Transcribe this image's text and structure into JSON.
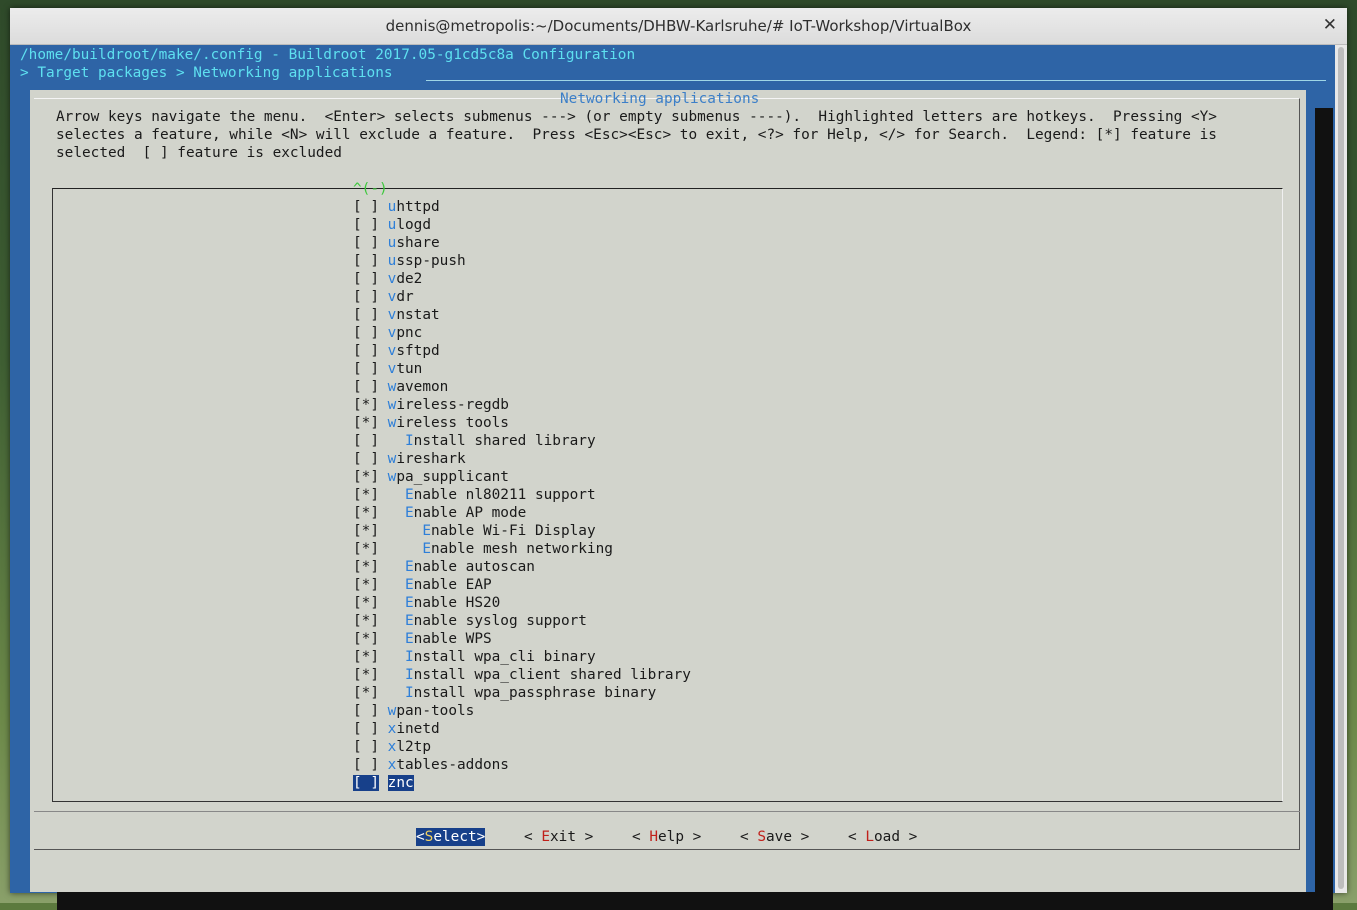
{
  "window": {
    "title": "dennis@metropolis:~/Documents/DHBW-Karlsruhe/# IoT-Workshop/VirtualBox",
    "close_glyph": "✕"
  },
  "terminal": {
    "config_path": "/home/buildroot/make/.config - Buildroot 2017.05-g1cd5c8a Configuration",
    "breadcrumb": "> Target packages > Networking applications"
  },
  "dialog": {
    "title": "Networking applications",
    "help_lines": [
      "Arrow keys navigate the menu.  <Enter> selects submenus ---> (or empty submenus ----).  Highlighted letters are hotkeys.  Pressing <Y>",
      "selectes a feature, while <N> will exclude a feature.  Press <Esc><Esc> to exit, <?> for Help, </> for Search.  Legend: [*] feature is",
      "selected  [ ] feature is excluded"
    ],
    "scroll_indicator": "^(-)",
    "items": [
      {
        "box": "[ ]",
        "indent": "",
        "hot": "u",
        "rest": "httpd"
      },
      {
        "box": "[ ]",
        "indent": "",
        "hot": "u",
        "rest": "logd"
      },
      {
        "box": "[ ]",
        "indent": "",
        "hot": "u",
        "rest": "share"
      },
      {
        "box": "[ ]",
        "indent": "",
        "hot": "u",
        "rest": "ssp-push"
      },
      {
        "box": "[ ]",
        "indent": "",
        "hot": "v",
        "rest": "de2"
      },
      {
        "box": "[ ]",
        "indent": "",
        "hot": "v",
        "rest": "dr"
      },
      {
        "box": "[ ]",
        "indent": "",
        "hot": "v",
        "rest": "nstat"
      },
      {
        "box": "[ ]",
        "indent": "",
        "hot": "v",
        "rest": "pnc"
      },
      {
        "box": "[ ]",
        "indent": "",
        "hot": "v",
        "rest": "sftpd"
      },
      {
        "box": "[ ]",
        "indent": "",
        "hot": "v",
        "rest": "tun"
      },
      {
        "box": "[ ]",
        "indent": "",
        "hot": "w",
        "rest": "avemon"
      },
      {
        "box": "[*]",
        "indent": "",
        "hot": "w",
        "rest": "ireless-regdb"
      },
      {
        "box": "[*]",
        "indent": "",
        "hot": "w",
        "rest": "ireless tools"
      },
      {
        "box": "[ ]",
        "indent": "  ",
        "hot": "I",
        "rest": "nstall shared library"
      },
      {
        "box": "[ ]",
        "indent": "",
        "hot": "w",
        "rest": "ireshark"
      },
      {
        "box": "[*]",
        "indent": "",
        "hot": "w",
        "rest": "pa_supplicant"
      },
      {
        "box": "[*]",
        "indent": "  ",
        "hot": "E",
        "rest": "nable nl80211 support"
      },
      {
        "box": "[*]",
        "indent": "  ",
        "hot": "E",
        "rest": "nable AP mode"
      },
      {
        "box": "[*]",
        "indent": "    ",
        "hot": "E",
        "rest": "nable Wi-Fi Display"
      },
      {
        "box": "[*]",
        "indent": "    ",
        "hot": "E",
        "rest": "nable mesh networking"
      },
      {
        "box": "[*]",
        "indent": "  ",
        "hot": "E",
        "rest": "nable autoscan"
      },
      {
        "box": "[*]",
        "indent": "  ",
        "hot": "E",
        "rest": "nable EAP"
      },
      {
        "box": "[*]",
        "indent": "  ",
        "hot": "E",
        "rest": "nable HS20"
      },
      {
        "box": "[*]",
        "indent": "  ",
        "hot": "E",
        "rest": "nable syslog support"
      },
      {
        "box": "[*]",
        "indent": "  ",
        "hot": "E",
        "rest": "nable WPS"
      },
      {
        "box": "[*]",
        "indent": "  ",
        "hot": "I",
        "rest": "nstall wpa_cli binary"
      },
      {
        "box": "[*]",
        "indent": "  ",
        "hot": "I",
        "rest": "nstall wpa_client shared library"
      },
      {
        "box": "[*]",
        "indent": "  ",
        "hot": "I",
        "rest": "nstall wpa_passphrase binary"
      },
      {
        "box": "[ ]",
        "indent": "",
        "hot": "w",
        "rest": "pan-tools"
      },
      {
        "box": "[ ]",
        "indent": "",
        "hot": "x",
        "rest": "inetd"
      },
      {
        "box": "[ ]",
        "indent": "",
        "hot": "x",
        "rest": "l2tp"
      },
      {
        "box": "[ ]",
        "indent": "",
        "hot": "x",
        "rest": "tables-addons"
      },
      {
        "box": "[ ]",
        "indent": "",
        "hot": "z",
        "rest": "nc",
        "selected": true
      }
    ],
    "buttons": [
      {
        "pre": "<",
        "key": "S",
        "rest": "elect",
        "post": ">",
        "selected": true
      },
      {
        "pre": "< ",
        "key": "E",
        "rest": "xit",
        "post": " >"
      },
      {
        "pre": "< ",
        "key": "H",
        "rest": "elp",
        "post": " >"
      },
      {
        "pre": "< ",
        "key": "S",
        "rest": "ave",
        "post": " >"
      },
      {
        "pre": "< ",
        "key": "L",
        "rest": "oad",
        "post": " >"
      }
    ]
  },
  "colors": {
    "terminal_bg": "#2e64a6",
    "dialog_bg": "#d2d4cc",
    "hotkey": "#2e7fd8",
    "selection": "#17408a",
    "button_key": "#c0201a"
  }
}
